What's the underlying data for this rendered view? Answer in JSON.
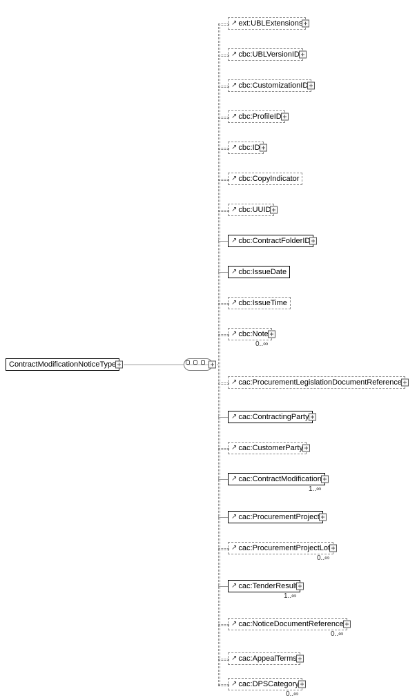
{
  "root": {
    "label": "ContractModificationNoticeType"
  },
  "children": [
    {
      "id": "ext-ubl-extensions",
      "label": "ext:UBLExtensions",
      "optional": true,
      "arrow": true,
      "expand": true,
      "cardinality": null
    },
    {
      "id": "cbc-ubl-version-id",
      "label": "cbc:UBLVersionID",
      "optional": true,
      "arrow": true,
      "expand": true,
      "cardinality": null
    },
    {
      "id": "cbc-customization-id",
      "label": "cbc:CustomizationID",
      "optional": true,
      "arrow": true,
      "expand": true,
      "cardinality": null
    },
    {
      "id": "cbc-profile-id",
      "label": "cbc:ProfileID",
      "optional": true,
      "arrow": true,
      "expand": true,
      "cardinality": null
    },
    {
      "id": "cbc-id",
      "label": "cbc:ID",
      "optional": true,
      "arrow": true,
      "expand": true,
      "cardinality": null
    },
    {
      "id": "cbc-copy-indicator",
      "label": "cbc:CopyIndicator",
      "optional": true,
      "arrow": true,
      "expand": false,
      "cardinality": null
    },
    {
      "id": "cbc-uuid",
      "label": "cbc:UUID",
      "optional": true,
      "arrow": true,
      "expand": true,
      "cardinality": null
    },
    {
      "id": "cbc-contract-folder-id",
      "label": "cbc:ContractFolderID",
      "optional": false,
      "arrow": true,
      "expand": true,
      "cardinality": null
    },
    {
      "id": "cbc-issue-date",
      "label": "cbc:IssueDate",
      "optional": false,
      "arrow": true,
      "expand": false,
      "cardinality": null
    },
    {
      "id": "cbc-issue-time",
      "label": "cbc:IssueTime",
      "optional": true,
      "arrow": true,
      "expand": false,
      "cardinality": null
    },
    {
      "id": "cbc-note",
      "label": "cbc:Note",
      "optional": true,
      "arrow": true,
      "expand": true,
      "cardinality": "0..∞"
    },
    {
      "id": "cac-procurement-legislation-doc-ref",
      "label": "cac:ProcurementLegislationDocumentReference",
      "optional": true,
      "arrow": true,
      "expand": true,
      "cardinality": null
    },
    {
      "id": "cac-contracting-party",
      "label": "cac:ContractingParty",
      "optional": false,
      "arrow": true,
      "expand": true,
      "cardinality": null
    },
    {
      "id": "cac-customer-party",
      "label": "cac:CustomerParty",
      "optional": true,
      "arrow": true,
      "expand": true,
      "cardinality": null
    },
    {
      "id": "cac-contract-modification",
      "label": "cac:ContractModification",
      "optional": false,
      "arrow": true,
      "expand": true,
      "cardinality": "1..∞"
    },
    {
      "id": "cac-procurement-project",
      "label": "cac:ProcurementProject",
      "optional": false,
      "arrow": true,
      "expand": true,
      "cardinality": null
    },
    {
      "id": "cac-procurement-project-lot",
      "label": "cac:ProcurementProjectLot",
      "optional": true,
      "arrow": true,
      "expand": true,
      "cardinality": "0..∞"
    },
    {
      "id": "cac-tender-result",
      "label": "cac:TenderResult",
      "optional": false,
      "arrow": true,
      "expand": true,
      "cardinality": "1..∞"
    },
    {
      "id": "cac-notice-document-reference",
      "label": "cac:NoticeDocumentReference",
      "optional": true,
      "arrow": true,
      "expand": true,
      "cardinality": "0..∞"
    },
    {
      "id": "cac-appeal-terms",
      "label": "cac:AppealTerms",
      "optional": true,
      "arrow": true,
      "expand": true,
      "cardinality": null
    },
    {
      "id": "cac-dps-category",
      "label": "cac:DPSCategory",
      "optional": true,
      "arrow": true,
      "expand": true,
      "cardinality": "0..∞"
    }
  ],
  "layout": {
    "rootTop": 519,
    "rootLeft": 8,
    "compositorLeft": 266,
    "compositorTop": 519,
    "trunkX": 316,
    "childLeft": 330,
    "childTops": [
      25,
      70,
      115,
      160,
      205,
      250,
      295,
      340,
      385,
      430,
      475,
      545,
      595,
      640,
      685,
      740,
      785,
      840,
      895,
      945,
      982
    ],
    "cardinalityOffset": 18
  }
}
